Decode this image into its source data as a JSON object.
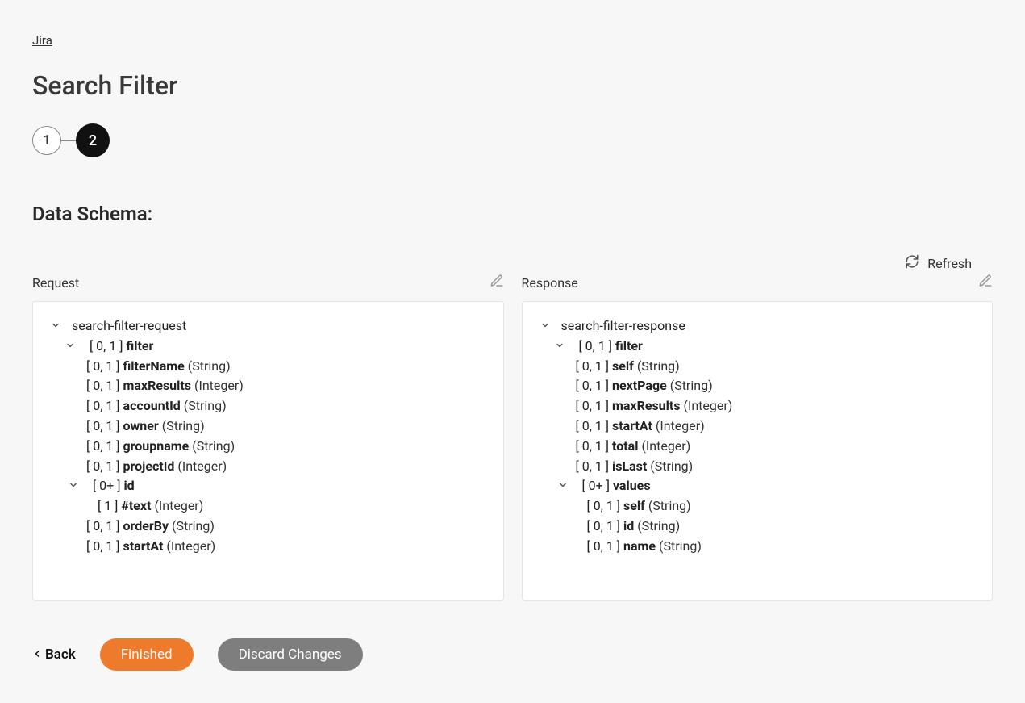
{
  "breadcrumb": "Jira",
  "title": "Search Filter",
  "stepper": {
    "step1": "1",
    "step2": "2"
  },
  "section_title": "Data Schema:",
  "refresh_label": "Refresh",
  "request": {
    "label": "Request",
    "root": "search-filter-request",
    "filter_card": "[ 0, 1 ]",
    "filter_name": "filter",
    "fields": [
      {
        "card": "[ 0, 1 ]",
        "name": "filterName",
        "type": "(String)"
      },
      {
        "card": "[ 0, 1 ]",
        "name": "maxResults",
        "type": "(Integer)"
      },
      {
        "card": "[ 0, 1 ]",
        "name": "accountId",
        "type": "(String)"
      },
      {
        "card": "[ 0, 1 ]",
        "name": "owner",
        "type": "(String)"
      },
      {
        "card": "[ 0, 1 ]",
        "name": "groupname",
        "type": "(String)"
      },
      {
        "card": "[ 0, 1 ]",
        "name": "projectId",
        "type": "(Integer)"
      }
    ],
    "id_group": {
      "card": "[ 0+ ]",
      "name": "id"
    },
    "id_child": {
      "card": "[ 1 ]",
      "name": "#text",
      "type": "(Integer)"
    },
    "tail": [
      {
        "card": "[ 0, 1 ]",
        "name": "orderBy",
        "type": "(String)"
      },
      {
        "card": "[ 0, 1 ]",
        "name": "startAt",
        "type": "(Integer)"
      }
    ]
  },
  "response": {
    "label": "Response",
    "root": "search-filter-response",
    "filter_card": "[ 0, 1 ]",
    "filter_name": "filter",
    "fields": [
      {
        "card": "[ 0, 1 ]",
        "name": "self",
        "type": "(String)"
      },
      {
        "card": "[ 0, 1 ]",
        "name": "nextPage",
        "type": "(String)"
      },
      {
        "card": "[ 0, 1 ]",
        "name": "maxResults",
        "type": "(Integer)"
      },
      {
        "card": "[ 0, 1 ]",
        "name": "startAt",
        "type": "(Integer)"
      },
      {
        "card": "[ 0, 1 ]",
        "name": "total",
        "type": "(Integer)"
      },
      {
        "card": "[ 0, 1 ]",
        "name": "isLast",
        "type": "(String)"
      }
    ],
    "values_group": {
      "card": "[ 0+ ]",
      "name": "values"
    },
    "values_children": [
      {
        "card": "[ 0, 1 ]",
        "name": "self",
        "type": "(String)"
      },
      {
        "card": "[ 0, 1 ]",
        "name": "id",
        "type": "(String)"
      },
      {
        "card": "[ 0, 1 ]",
        "name": "name",
        "type": "(String)"
      }
    ]
  },
  "footer": {
    "back": "Back",
    "finished": "Finished",
    "discard": "Discard Changes"
  }
}
